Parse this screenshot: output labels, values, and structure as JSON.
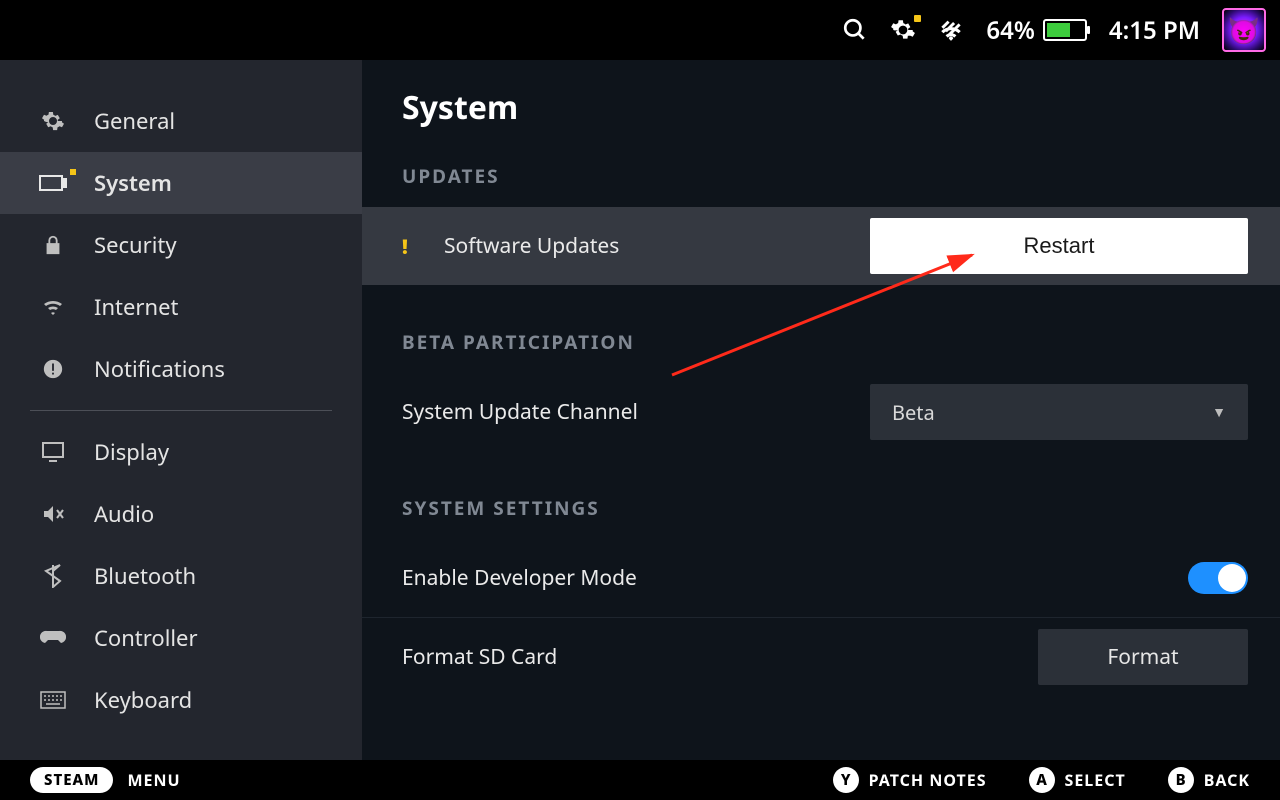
{
  "statusbar": {
    "battery_text": "64%",
    "battery_fill_pct": 64,
    "time": "4:15 PM"
  },
  "sidebar": {
    "items": [
      {
        "label": "General"
      },
      {
        "label": "System"
      },
      {
        "label": "Security"
      },
      {
        "label": "Internet"
      },
      {
        "label": "Notifications"
      },
      {
        "label": "Display"
      },
      {
        "label": "Audio"
      },
      {
        "label": "Bluetooth"
      },
      {
        "label": "Controller"
      },
      {
        "label": "Keyboard"
      }
    ],
    "active_index": 1
  },
  "page": {
    "title": "System",
    "sections": {
      "updates_hdr": "UPDATES",
      "software_updates_label": "Software Updates",
      "restart_label": "Restart",
      "beta_hdr": "BETA PARTICIPATION",
      "update_channel_label": "System Update Channel",
      "update_channel_value": "Beta",
      "settings_hdr": "SYSTEM SETTINGS",
      "dev_mode_label": "Enable Developer Mode",
      "dev_mode_on": true,
      "format_sd_label": "Format SD Card",
      "format_btn_label": "Format"
    }
  },
  "bottombar": {
    "steam": "STEAM",
    "menu": "MENU",
    "hints": [
      {
        "button": "Y",
        "label": "PATCH NOTES"
      },
      {
        "button": "A",
        "label": "SELECT"
      },
      {
        "button": "B",
        "label": "BACK"
      }
    ]
  },
  "annotation": {
    "arrow_points_to": "restart-button"
  }
}
